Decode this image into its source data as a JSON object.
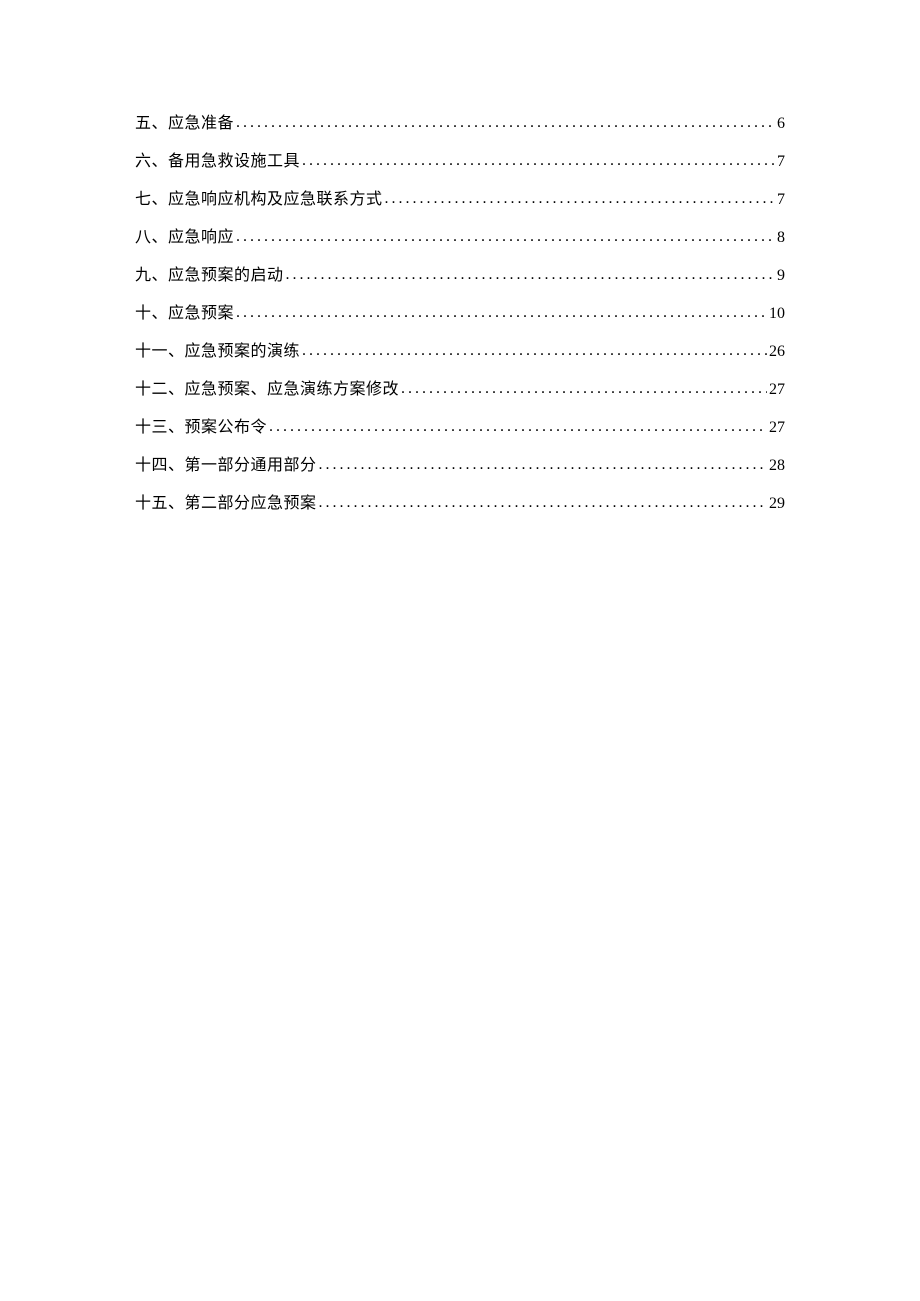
{
  "toc": {
    "entries": [
      {
        "title": "五、应急准备",
        "page": "6"
      },
      {
        "title": "六、备用急救设施工具",
        "page": "7"
      },
      {
        "title": "七、应急响应机构及应急联系方式",
        "page": "7"
      },
      {
        "title": "八、应急响应",
        "page": "8"
      },
      {
        "title": "九、应急预案的启动",
        "page": "9"
      },
      {
        "title": "十、应急预案",
        "page": "10"
      },
      {
        "title": "十一、应急预案的演练",
        "page": "26"
      },
      {
        "title": "十二、应急预案、应急演练方案修改",
        "page": "27"
      },
      {
        "title": "十三、预案公布令",
        "page": "27"
      },
      {
        "title": "十四、第一部分通用部分",
        "page": "28"
      },
      {
        "title": "十五、第二部分应急预案",
        "page": "29"
      }
    ]
  }
}
